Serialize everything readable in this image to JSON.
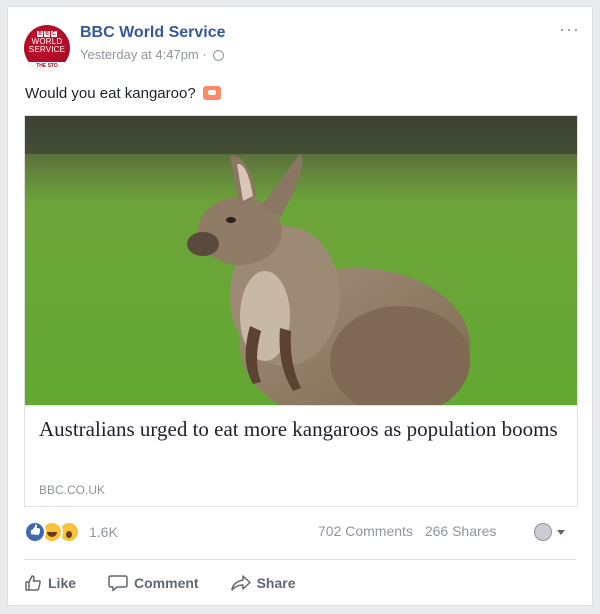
{
  "post": {
    "avatar_top_text": "BBC",
    "avatar_mid_text": "WORLD SERVICE",
    "avatar_strip_text": "THE STO",
    "page_name": "BBC World Service",
    "timestamp": "Yesterday at 4:47pm",
    "separator": "·",
    "more_label": "···",
    "text": "Would you eat kangaroo?",
    "emoji_icon": "cooking-pot-icon"
  },
  "link": {
    "headline": "Australians urged to eat more kangaroos as population booms",
    "domain": "BBC.CO.UK",
    "image_subject": "kangaroo-photo"
  },
  "engagement": {
    "reactions": [
      "like",
      "haha",
      "wow"
    ],
    "reaction_count": "1.6K",
    "comments": "702 Comments",
    "shares": "266 Shares"
  },
  "actions": {
    "like_label": "Like",
    "comment_label": "Comment",
    "share_label": "Share"
  },
  "colors": {
    "link_blue": "#365899",
    "meta_gray": "#90949c",
    "bbc_red": "#c8102e"
  }
}
